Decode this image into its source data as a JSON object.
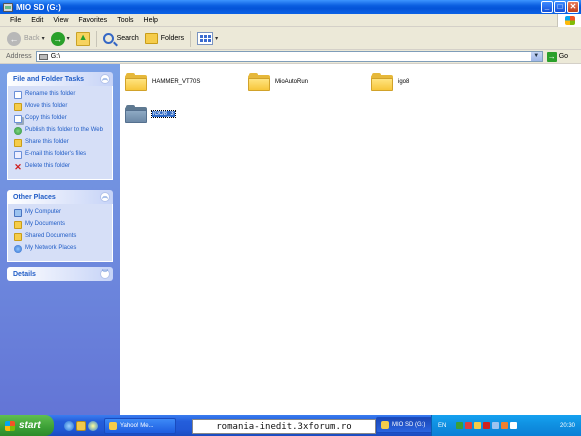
{
  "window": {
    "title": "MIO SD (G:)",
    "buttons": {
      "minimize": "_",
      "maximize": "□",
      "close": "✕"
    }
  },
  "menu": [
    "File",
    "Edit",
    "View",
    "Favorites",
    "Tools",
    "Help"
  ],
  "toolbar": {
    "back_label": "Back",
    "search_label": "Search",
    "folders_label": "Folders"
  },
  "address": {
    "label": "Address",
    "value": "G:\\",
    "go_label": "Go"
  },
  "left_pane": {
    "file_tasks": {
      "title": "File and Folder Tasks",
      "items": [
        {
          "label": "Rename this folder",
          "icon": "rename-icon"
        },
        {
          "label": "Move this folder",
          "icon": "move-icon"
        },
        {
          "label": "Copy this folder",
          "icon": "copy-icon"
        },
        {
          "label": "Publish this folder to the Web",
          "icon": "globe-icon"
        },
        {
          "label": "Share this folder",
          "icon": "share-icon"
        },
        {
          "label": "E-mail this folder's files",
          "icon": "email-icon"
        },
        {
          "label": "Delete this folder",
          "icon": "delete-icon"
        }
      ]
    },
    "other_places": {
      "title": "Other Places",
      "items": [
        {
          "label": "My Computer",
          "icon": "computer-icon"
        },
        {
          "label": "My Documents",
          "icon": "documents-icon"
        },
        {
          "label": "Shared Documents",
          "icon": "shared-documents-icon"
        },
        {
          "label": "My Network Places",
          "icon": "network-icon"
        }
      ]
    },
    "details": {
      "title": "Details"
    }
  },
  "files": [
    {
      "name": "HAMMER_VT70S",
      "selected": false
    },
    {
      "name": "MioAutoRun",
      "selected": false
    },
    {
      "name": "igo8",
      "selected": false
    },
    {
      "name": "iGO8_3",
      "selected": true
    }
  ],
  "taskbar": {
    "start_label": "start",
    "task_buttons": [
      {
        "label": "Yahoo! Me...",
        "active": false
      },
      {
        "label": "MIO SD (G:)",
        "active": true
      }
    ],
    "watermark": "romania-inedit.3xforum.ro",
    "language": "EN",
    "clock": "20:30"
  }
}
